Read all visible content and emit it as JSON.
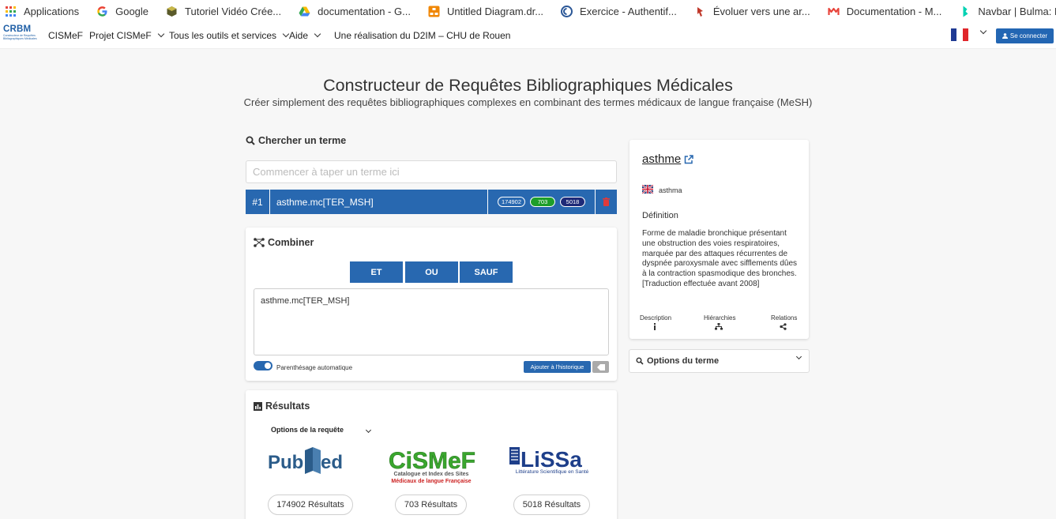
{
  "bookmarks": [
    {
      "label": "Applications",
      "icon": "apps-grid-icon"
    },
    {
      "label": "Google",
      "icon": "google-icon"
    },
    {
      "label": "Tutoriel Vidéo Crée...",
      "icon": "cube-icon"
    },
    {
      "label": "documentation - G...",
      "icon": "drive-icon"
    },
    {
      "label": "Untitled Diagram.dr...",
      "icon": "diagram-icon"
    },
    {
      "label": "Exercice - Authentif...",
      "icon": "edge-icon"
    },
    {
      "label": "Évoluer vers une ar...",
      "icon": "pin-icon"
    },
    {
      "label": "Documentation - M...",
      "icon": "m-icon"
    },
    {
      "label": "Navbar | Bulma: Fre...",
      "icon": "bulma-icon"
    }
  ],
  "navbar": {
    "logo_text": "CRBM",
    "logo_sub": "Constructeur de Requêtes Bibliographiques Médicales",
    "items": [
      "CISMeF",
      "Projet CISMeF",
      "Tous les outils et services",
      "Aide",
      "Une réalisation du D2IM – CHU de Rouen"
    ],
    "login": "Se connecter"
  },
  "header": {
    "title": "Constructeur de Requêtes Bibliographiques Médicales",
    "subtitle": "Créer simplement des requêtes bibliographiques complexes en combinant des termes médicaux de langue française (MeSH)"
  },
  "search": {
    "heading": "Chercher un terme",
    "placeholder": "Commencer à taper un terme ici"
  },
  "term_row": {
    "number": "#1",
    "query": "asthme.mc[TER_MSH]",
    "badges": [
      "174902",
      "703",
      "5018"
    ]
  },
  "combine": {
    "heading": "Combiner",
    "buttons": [
      "ET",
      "OU",
      "SAUF"
    ],
    "query": "asthme.mc[TER_MSH]",
    "toggle_label": "Parenthésage automatique",
    "history_button": "Ajouter à l'historique"
  },
  "results": {
    "heading": "Résultats",
    "options_label": "Options de la requête",
    "sources": [
      {
        "name": "PubMed",
        "count_label": "174902 Résultats"
      },
      {
        "name": "CiSMeF",
        "tagline": "Catalogue et Index des Sites Médicaux de langue Française",
        "count_label": "703 Résultats"
      },
      {
        "name": "LiSSa",
        "tagline": "Littérature Scientifique en Santé",
        "count_label": "5018 Résultats"
      }
    ]
  },
  "term_panel": {
    "term": "asthme",
    "english": "asthma",
    "definition_label": "Définition",
    "definition": "Forme de maladie bronchique présentant une obstruction des voies respiratoires, marquée par des attaques récurrentes de dyspnée paroxysmale avec sifflements dûes à la contraction spasmodique des bronches. [Traduction effectuée avant 2008]",
    "tabs": [
      "Description",
      "Hiérarchies",
      "Relations"
    ],
    "options_label": "Options du terme"
  },
  "colors": {
    "primary": "#2868b0",
    "badge_green": "#1e9e2a",
    "badge_navy": "#1e2a78",
    "delete": "#e03a3a"
  }
}
